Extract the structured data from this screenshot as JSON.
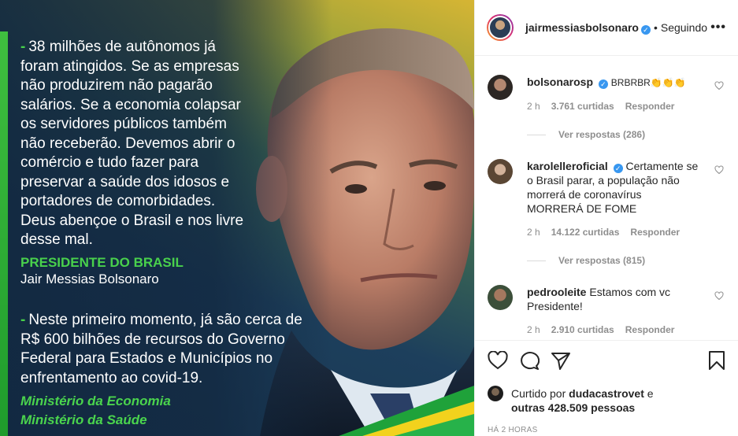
{
  "post": {
    "quote1_dash": "-",
    "quote1": "38 milhões de autônomos já foram atingidos. Se as empresas não produzirem não pagarão salários. Se a economia colapsar os servidores públicos também não receberão. Devemos abrir o comércio e tudo fazer para preservar a saúde dos idosos e portadores de comorbidades. Deus abençoe o Brasil e nos livre desse mal.",
    "signature_title": "PRESIDENTE DO BRASIL",
    "signature_name": "Jair Messias Bolsonaro",
    "quote2_dash": "-",
    "quote2": "Neste primeiro momento, já são cerca de R$ 600 bilhões de recursos do Governo Federal para Estados e Municípios no enfrentamento ao covid-19.",
    "ministry1": "Ministério da Economia",
    "ministry2": "Ministério da Saúde"
  },
  "header": {
    "username": "jairmessiasbolsonaro",
    "verified_mark": "✓",
    "dot": "•",
    "follow_status": "Seguindo",
    "more": "•••"
  },
  "comments": [
    {
      "username": "bolsonarosp",
      "text": "BRBRBR👏👏👏",
      "time": "2 h",
      "likes": "3.761 curtidas",
      "reply": "Responder",
      "view_replies": "Ver respostas (286)"
    },
    {
      "username": "karolelleroficial",
      "text": "Certamente se o Brasil parar, a população não morrerá de coronavírus MORRERÁ DE FOME",
      "time": "2 h",
      "likes": "14.122 curtidas",
      "reply": "Responder",
      "view_replies": "Ver respostas (815)"
    },
    {
      "username": "pedrooleite",
      "text": "Estamos com vc Presidente!",
      "time": "2 h",
      "likes": "2.910 curtidas",
      "reply": "Responder"
    }
  ],
  "likes": {
    "prefix": "Curtido por",
    "user": "dudacastrovet",
    "connector": "e",
    "others": "outras 428.509 pessoas"
  },
  "timestamp": "HÁ 2 HORAS",
  "icons": [
    "heart-icon",
    "comment-icon",
    "share-icon",
    "bookmark-icon",
    "more-icon",
    "verified-icon"
  ],
  "colors": {
    "accent_green": "#47d04a",
    "verified_blue": "#3897f0",
    "text_dark": "#262626",
    "text_muted": "#8e8e8e"
  }
}
